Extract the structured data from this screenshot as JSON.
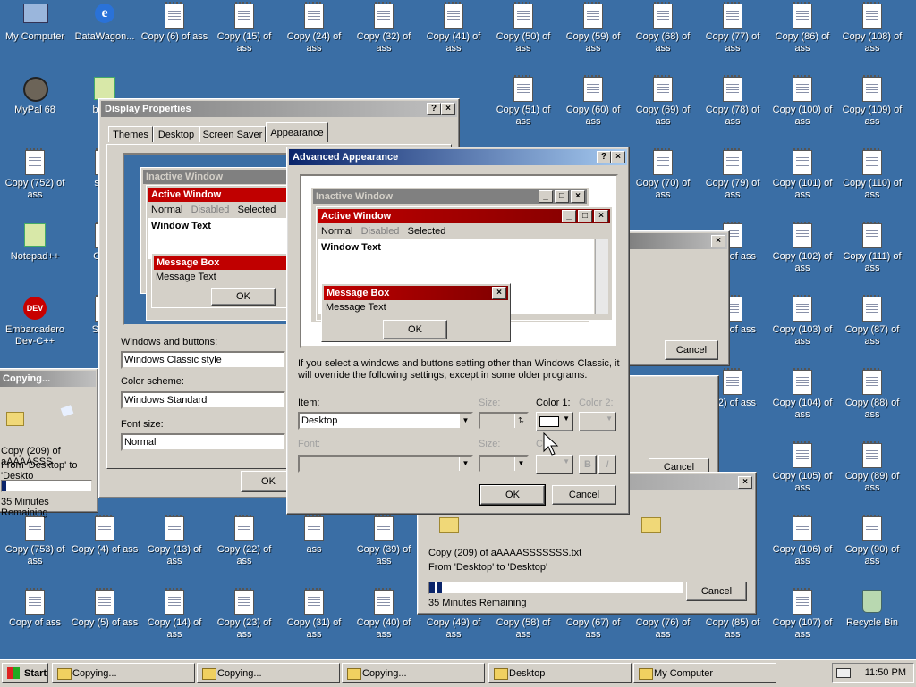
{
  "desktop": {
    "icons": [
      {
        "label": "My Computer",
        "icon": "my-computer-icon"
      },
      {
        "label": "DataWagon...",
        "icon": "internet-explorer-icon"
      },
      {
        "label": "Copy (6) of ass",
        "icon": "text-file-icon"
      },
      {
        "label": "Copy (15) of ass",
        "icon": "text-file-icon"
      },
      {
        "label": "Copy (24) of ass",
        "icon": "text-file-icon"
      },
      {
        "label": "Copy (32) of ass",
        "icon": "text-file-icon"
      },
      {
        "label": "Copy (41) of ass",
        "icon": "text-file-icon"
      },
      {
        "label": "Copy (50) of ass",
        "icon": "text-file-icon"
      },
      {
        "label": "Copy (59) of ass",
        "icon": "text-file-icon"
      },
      {
        "label": "Copy (68) of ass",
        "icon": "text-file-icon"
      },
      {
        "label": "Copy (77) of ass",
        "icon": "text-file-icon"
      },
      {
        "label": "Copy (86) of ass",
        "icon": "text-file-icon"
      },
      {
        "label": "Copy (108) of ass",
        "icon": "text-file-icon"
      },
      {
        "label": "MyPal 68",
        "icon": "mypal-icon"
      },
      {
        "label": "boots",
        "icon": "app-icon"
      },
      {
        "label": "Copy (51) of ass",
        "icon": "text-file-icon"
      },
      {
        "label": "Copy (60) of ass",
        "icon": "text-file-icon"
      },
      {
        "label": "Copy (69) of ass",
        "icon": "text-file-icon"
      },
      {
        "label": "Copy (78) of ass",
        "icon": "text-file-icon"
      },
      {
        "label": "Copy (100) of ass",
        "icon": "text-file-icon"
      },
      {
        "label": "Copy (109) of ass",
        "icon": "text-file-icon"
      },
      {
        "label": "Copy (752) of ass",
        "icon": "text-file-icon"
      },
      {
        "label": "scan",
        "icon": "text-file-icon"
      },
      {
        "label": "Copy (70) of ass",
        "icon": "text-file-icon"
      },
      {
        "label": "Copy (79) of ass",
        "icon": "text-file-icon"
      },
      {
        "label": "Copy (101) of ass",
        "icon": "text-file-icon"
      },
      {
        "label": "Copy (110) of ass",
        "icon": "text-file-icon"
      },
      {
        "label": "Notepad++",
        "icon": "notepad-plus-plus-icon"
      },
      {
        "label": "Copy",
        "icon": "text-file-icon"
      },
      {
        "label": "(80) of ass",
        "icon": "text-file-icon"
      },
      {
        "label": "Copy (102) of ass",
        "icon": "text-file-icon"
      },
      {
        "label": "Copy (111) of ass",
        "icon": "text-file-icon"
      },
      {
        "label": "Embarcadero Dev-C++",
        "icon": "dev-cpp-icon"
      },
      {
        "label": "Shutd",
        "icon": "shutdown-icon"
      },
      {
        "label": "(81) of ass",
        "icon": "text-file-icon"
      },
      {
        "label": "Copy (103) of ass",
        "icon": "text-file-icon"
      },
      {
        "label": "Copy (87) of ass",
        "icon": "text-file-icon"
      },
      {
        "label": "(82) of ass",
        "icon": "text-file-icon"
      },
      {
        "label": "Copy (104) of ass",
        "icon": "text-file-icon"
      },
      {
        "label": "Copy (88) of ass",
        "icon": "text-file-icon"
      },
      {
        "label": "Copy (105) of ass",
        "icon": "text-file-icon"
      },
      {
        "label": "Copy (89) of ass",
        "icon": "text-file-icon"
      },
      {
        "label": "Copy (753) of ass",
        "icon": "text-file-icon"
      },
      {
        "label": "Copy (4) of ass",
        "icon": "text-file-icon"
      },
      {
        "label": "Copy (13) of ass",
        "icon": "text-file-icon"
      },
      {
        "label": "Copy (22) of ass",
        "icon": "text-file-icon"
      },
      {
        "label": "ass",
        "icon": "text-file-icon"
      },
      {
        "label": "Copy (39) of ass",
        "icon": "text-file-icon"
      },
      {
        "label": "Copy (106) of ass",
        "icon": "text-file-icon"
      },
      {
        "label": "Copy (90) of ass",
        "icon": "text-file-icon"
      },
      {
        "label": "Copy of ass",
        "icon": "text-file-icon"
      },
      {
        "label": "Copy (5) of ass",
        "icon": "text-file-icon"
      },
      {
        "label": "Copy (14) of ass",
        "icon": "text-file-icon"
      },
      {
        "label": "Copy (23) of ass",
        "icon": "text-file-icon"
      },
      {
        "label": "Copy (31) of ass",
        "icon": "text-file-icon"
      },
      {
        "label": "Copy (40) of ass",
        "icon": "text-file-icon"
      },
      {
        "label": "Copy (49) of ass",
        "icon": "text-file-icon"
      },
      {
        "label": "Copy (58) of ass",
        "icon": "text-file-icon"
      },
      {
        "label": "Copy (67) of ass",
        "icon": "text-file-icon"
      },
      {
        "label": "Copy (76) of ass",
        "icon": "text-file-icon"
      },
      {
        "label": "Copy (85) of ass",
        "icon": "text-file-icon"
      },
      {
        "label": "Copy (107) of ass",
        "icon": "text-file-icon"
      },
      {
        "label": "Recycle Bin",
        "icon": "recycle-bin-icon"
      }
    ]
  },
  "copy_left": {
    "title": "Copying...",
    "file_line": "Copy (209) of aAAAASSS",
    "from_line": "From 'Desktop' to 'Deskto",
    "remaining": "35 Minutes Remaining",
    "progress": 0.05
  },
  "copy_right": {
    "cancel_label": "Cancel"
  },
  "copy_mid": {
    "cancel_label": "Cancel"
  },
  "copy_bottom": {
    "file_line": "Copy (209) of aAAAASSSSSSS.txt",
    "from_line": "From 'Desktop' to 'Desktop'",
    "remaining": "35 Minutes Remaining",
    "cancel_label": "Cancel",
    "progress": 0.05
  },
  "display_props": {
    "title": "Display Properties",
    "help": "?",
    "close": "×",
    "tabs": [
      "Themes",
      "Desktop",
      "Screen Saver",
      "Appearance"
    ],
    "preview": {
      "inactive": "Inactive Window",
      "active": "Active Window",
      "menu_normal": "Normal",
      "menu_disabled": "Disabled",
      "menu_selected": "Selected",
      "window_text": "Window Text",
      "msgbox": "Message Box",
      "msgtext": "Message Text",
      "ok": "OK"
    },
    "wb_label": "Windows and buttons:",
    "wb_value": "Windows Classic style",
    "scheme_label": "Color scheme:",
    "scheme_value": "Windows Standard",
    "font_label": "Font size:",
    "font_value": "Normal",
    "ok": "OK"
  },
  "advanced": {
    "title": "Advanced Appearance",
    "help": "?",
    "close": "×",
    "preview": {
      "inactive": "Inactive Window",
      "active": "Active Window",
      "menu_normal": "Normal",
      "menu_disabled": "Disabled",
      "menu_selected": "Selected",
      "window_text": "Window Text",
      "msgbox": "Message Box",
      "msgtext": "Message Text",
      "ok": "OK"
    },
    "note": "If you select a windows and buttons setting other than Windows Classic, it will override the following settings, except in some older programs.",
    "item_label": "Item:",
    "item_value": "Desktop",
    "size_label": "Size:",
    "color1_label": "Color 1:",
    "color2_label": "Color 2:",
    "font_label": "Font:",
    "size2_label": "Size:",
    "color_label": "Co",
    "bold": "B",
    "italic": "I",
    "ok": "OK",
    "cancel": "Cancel"
  },
  "taskbar": {
    "start": "Start",
    "tasks": [
      "Copying...",
      "Copying...",
      "Copying...",
      "Desktop",
      "My Computer"
    ],
    "clock": "11:50 PM"
  },
  "colors": {
    "desktop": "#3a6ea5",
    "active_title": "#0a246a",
    "sample_active": "#c00000"
  }
}
